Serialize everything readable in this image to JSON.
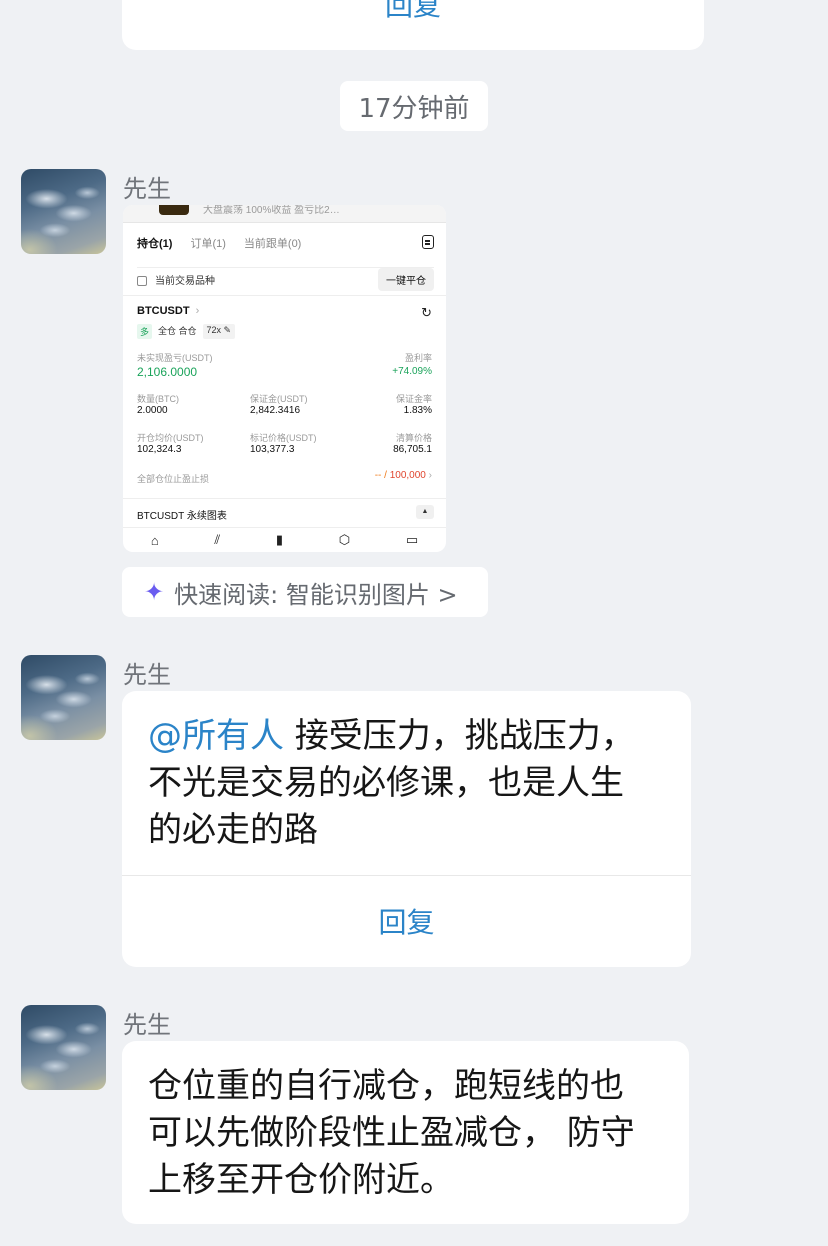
{
  "top_bubble": {
    "reply_label": "回复"
  },
  "time_divider": "17分钟前",
  "messages": [
    {
      "sender": "先生",
      "type": "image",
      "image": {
        "cut_text": "大盘震荡 100%收益 盈亏比2…",
        "tabs": [
          "持仓(1)",
          "订单(1)",
          "当前跟单(0)"
        ],
        "filter_label": "当前交易品种",
        "close_all_label": "一键平仓",
        "pair": "BTCUSDT",
        "tags": {
          "side": "多",
          "margin_mode": "全仓 合仓",
          "leverage": "72x ✎"
        },
        "unrealized_pnl_label": "未实现盈亏(USDT)",
        "unrealized_pnl": "2,106.0000",
        "roe_label": "盈利率",
        "roe": "+74.09%",
        "qty_label": "数量(BTC)",
        "qty": "2.0000",
        "margin_label": "保证金(USDT)",
        "margin": "2,842.3416",
        "margin_ratio_label": "保证金率",
        "margin_ratio": "1.83%",
        "entry_label": "开仓均价(USDT)",
        "entry": "102,324.3",
        "mark_label": "标记价格(USDT)",
        "mark": "103,377.3",
        "liq_label": "清算价格",
        "liq": "86,705.1",
        "tpsl_label": "全部仓位止盈止损",
        "tpsl_dash": "-- /",
        "tpsl_value": "100,000",
        "chart_label": "BTCUSDT 永续图表"
      },
      "quick_read": "快速阅读: 智能识别图片 >"
    },
    {
      "sender": "先生",
      "type": "text",
      "mention": "@所有人",
      "lines": [
        " 接受压力，挑战压力，",
        "不光是交易的必修课，也是人生",
        "的必走的路"
      ],
      "reply_label": "回复"
    },
    {
      "sender": "先生",
      "type": "text",
      "lines": [
        "仓位重的自行减仓，跑短线的也",
        "可以先做阶段性止盈减仓， 防守",
        "上移至开仓价附近。"
      ]
    }
  ]
}
